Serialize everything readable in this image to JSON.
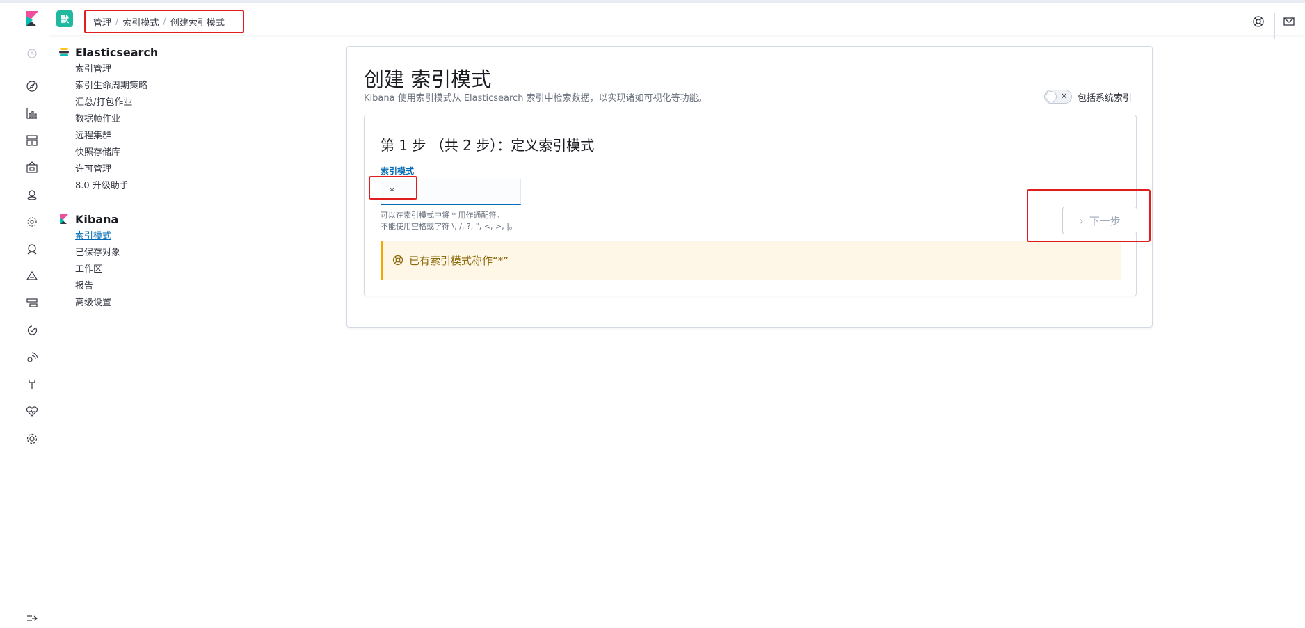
{
  "header": {
    "space_badge": "默",
    "breadcrumbs": [
      "管理",
      "索引模式",
      "创建索引模式"
    ]
  },
  "nav_rail": {
    "icons": [
      "clock-icon",
      "compass-icon",
      "visualize-icon",
      "dashboard-icon",
      "canvas-icon",
      "maps-icon",
      "ml-icon",
      "apm-icon",
      "logs-icon",
      "infra-icon",
      "uptime-icon",
      "siem-icon",
      "devtools-icon",
      "monitoring-icon",
      "management-icon"
    ],
    "collapse_icon": "collapse-icon"
  },
  "sidebar": {
    "groups": [
      {
        "title": "Elasticsearch",
        "items": [
          "索引管理",
          "索引生命周期策略",
          "汇总/打包作业",
          "数据帧作业",
          "远程集群",
          "快照存储库",
          "许可管理",
          "8.0 升级助手"
        ]
      },
      {
        "title": "Kibana",
        "items": [
          "索引模式",
          "已保存对象",
          "工作区",
          "报告",
          "高级设置"
        ],
        "active_index": 0
      }
    ]
  },
  "main": {
    "title": "创建 索引模式",
    "description": "Kibana 使用索引模式从 Elasticsearch 索引中检索数据，以实现诸如可视化等功能。",
    "toggle_label": "包括系统索引",
    "toggle_x": "×",
    "step_title": "第 1 步 （共 2 步）：定义索引模式",
    "field_label": "索引模式",
    "input_value": "*",
    "help_line1": "可以在索引模式中将 * 用作通配符。",
    "help_line2": "不能使用空格或字符 \\, /, ?, \", <, >, |。",
    "callout_text": "已有索引模式称作“*”",
    "next_button": "下一步"
  },
  "colors": {
    "accent": "#006bb4",
    "highlight": "#e11e1e",
    "callout_bg": "#fef6e6",
    "callout_border": "#f5a700"
  }
}
